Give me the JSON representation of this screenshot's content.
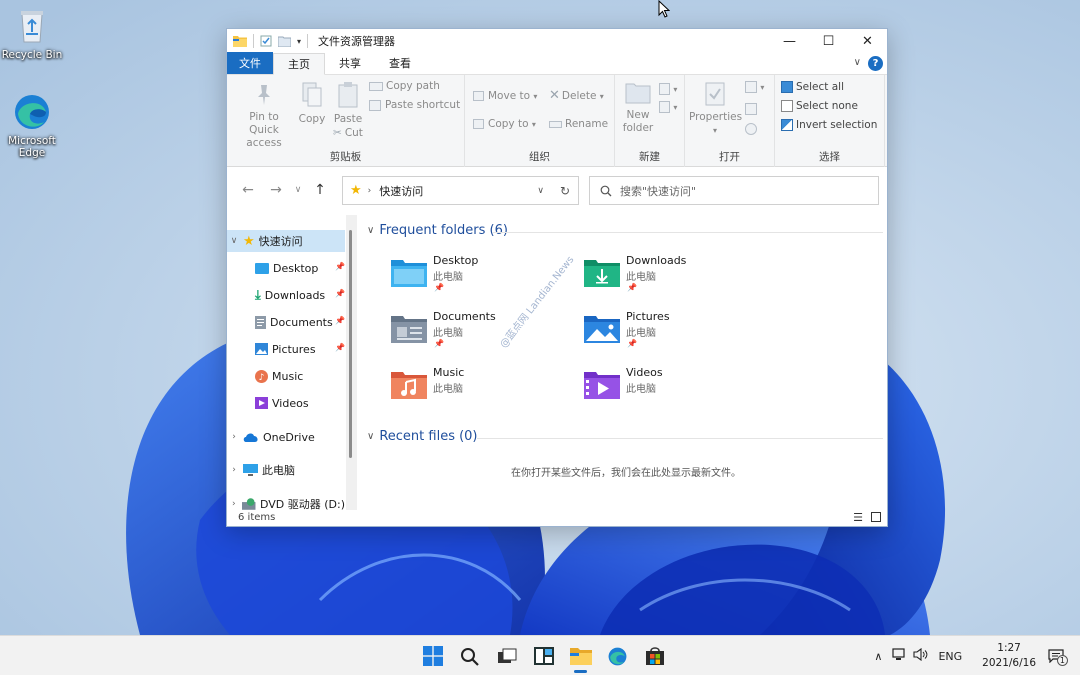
{
  "desktop": {
    "icons": [
      {
        "label": "Recycle Bin"
      },
      {
        "label": "Microsoft Edge"
      }
    ]
  },
  "window": {
    "title": "文件资源管理器",
    "controls": {
      "minimize": "—",
      "maximize": "☐",
      "close": "✕"
    },
    "tabs": {
      "file": "文件",
      "home": "主页",
      "share": "共享",
      "view": "查看"
    },
    "help": "?"
  },
  "ribbon": {
    "clipboard": {
      "pin": "Pin to Quick access",
      "copy": "Copy",
      "paste": "Paste",
      "copy_path": "Copy path",
      "paste_shortcut": "Paste shortcut",
      "cut": "Cut",
      "label": "剪贴板"
    },
    "organize": {
      "move_to": "Move to",
      "copy_to": "Copy to",
      "delete": "Delete",
      "rename": "Rename",
      "label": "组织"
    },
    "new": {
      "new_folder": "New folder",
      "label": "新建"
    },
    "open": {
      "properties": "Properties",
      "label": "打开"
    },
    "select": {
      "select_all": "Select all",
      "select_none": "Select none",
      "invert": "Invert selection",
      "label": "选择"
    }
  },
  "navbar": {
    "address": "快速访问",
    "search_placeholder": "搜索\"快速访问\""
  },
  "nav_pane": {
    "quick_access": "快速访问",
    "items": [
      {
        "label": "Desktop",
        "icon": "desktop-icon",
        "pinned": true
      },
      {
        "label": "Downloads",
        "icon": "downloads-icon",
        "pinned": true
      },
      {
        "label": "Documents",
        "icon": "documents-icon",
        "pinned": true
      },
      {
        "label": "Pictures",
        "icon": "pictures-icon",
        "pinned": true
      },
      {
        "label": "Music",
        "icon": "music-icon",
        "pinned": false
      },
      {
        "label": "Videos",
        "icon": "videos-icon",
        "pinned": false
      }
    ],
    "onedrive": "OneDrive",
    "this_pc": "此电脑",
    "dvd": "DVD 驱动器 (D:)"
  },
  "content": {
    "frequent_header": "Frequent folders (6)",
    "folders": [
      {
        "name": "Desktop",
        "location": "此电脑",
        "pinned": true
      },
      {
        "name": "Downloads",
        "location": "此电脑",
        "pinned": true
      },
      {
        "name": "Documents",
        "location": "此电脑",
        "pinned": true
      },
      {
        "name": "Pictures",
        "location": "此电脑",
        "pinned": true
      },
      {
        "name": "Music",
        "location": "此电脑",
        "pinned": false
      },
      {
        "name": "Videos",
        "location": "此电脑",
        "pinned": false
      }
    ],
    "recent_header": "Recent files (0)",
    "empty_message": "在你打开某些文件后，我们会在此处显示最新文件。",
    "watermark": "@蓝点网 Landian.News"
  },
  "statusbar": {
    "count": "6 items"
  },
  "taskbar": {
    "tray": {
      "lang": "ENG",
      "time": "1:27",
      "date": "2021/6/16",
      "notifications": "1"
    }
  },
  "colors": {
    "accent": "#1a6dc2",
    "selection": "#cce4f7",
    "folder_blue": "#1f4e9c"
  }
}
